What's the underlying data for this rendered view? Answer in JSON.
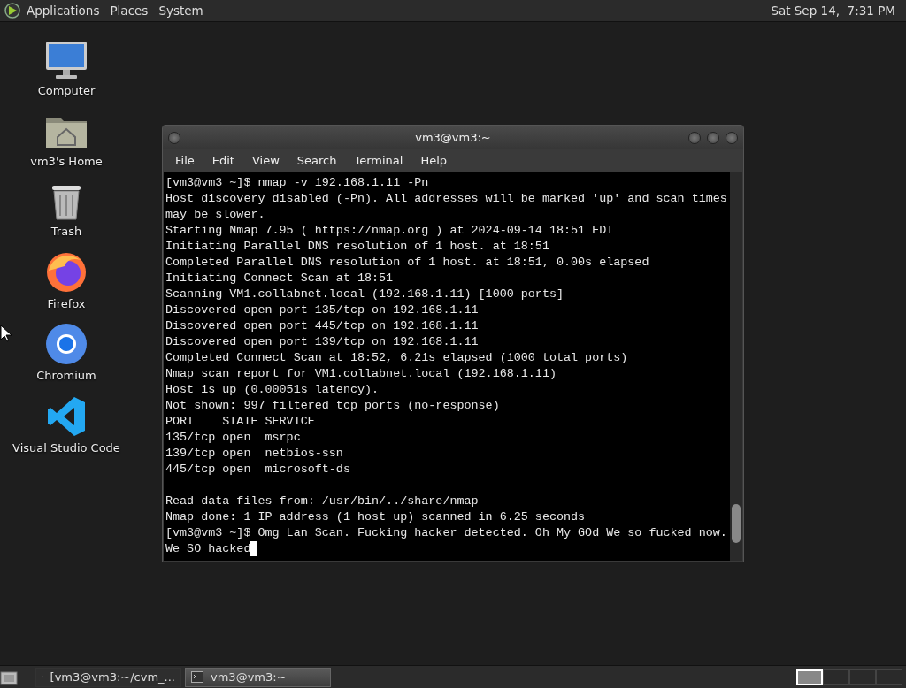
{
  "top_panel": {
    "menus": [
      "Applications",
      "Places",
      "System"
    ],
    "clock": "Sat Sep 14,  7:31 PM"
  },
  "desktop_icons": [
    {
      "kind": "computer",
      "label": "Computer"
    },
    {
      "kind": "home",
      "label": "vm3's Home"
    },
    {
      "kind": "trash",
      "label": "Trash"
    },
    {
      "kind": "firefox",
      "label": "Firefox"
    },
    {
      "kind": "chromium",
      "label": "Chromium"
    },
    {
      "kind": "vscode",
      "label": "Visual Studio Code"
    }
  ],
  "terminal": {
    "title": "vm3@vm3:~",
    "menu": [
      "File",
      "Edit",
      "View",
      "Search",
      "Terminal",
      "Help"
    ],
    "lines": [
      {
        "text": "[vm3@vm3 ~]$ nmap -v 192.168.1.11 -Pn"
      },
      {
        "text": "Host discovery disabled (-Pn). All addresses will be marked 'up' and scan times"
      },
      {
        "text": "may be slower."
      },
      {
        "text": "Starting Nmap 7.95 ( https://nmap.org ) at 2024-09-14 18:51 EDT"
      },
      {
        "text": "Initiating Parallel DNS resolution of 1 host. at 18:51"
      },
      {
        "text": "Completed Parallel DNS resolution of 1 host. at 18:51, 0.00s elapsed"
      },
      {
        "text": "Initiating Connect Scan at 18:51"
      },
      {
        "text": "Scanning VM1.collabnet.local (192.168.1.11) [1000 ports]"
      },
      {
        "text": "Discovered open port 135/tcp on 192.168.1.11"
      },
      {
        "text": "Discovered open port 445/tcp on 192.168.1.11"
      },
      {
        "text": "Discovered open port 139/tcp on 192.168.1.11"
      },
      {
        "text": "Completed Connect Scan at 18:52, 6.21s elapsed (1000 total ports)"
      },
      {
        "text": "Nmap scan report for VM1.collabnet.local (192.168.1.11)"
      },
      {
        "text": "Host is up (0.00051s latency)."
      },
      {
        "text": "Not shown: 997 filtered tcp ports (no-response)"
      },
      {
        "text": "PORT    STATE SERVICE"
      },
      {
        "text": "135/tcp open  msrpc"
      },
      {
        "text": "139/tcp open  netbios-ssn"
      },
      {
        "text": "445/tcp open  microsoft-ds"
      },
      {
        "text": "Read data files from: /usr/bin/../share/nmap",
        "blank_line_before": true
      },
      {
        "text": "Nmap done: 1 IP address (1 host up) scanned in 6.25 seconds"
      },
      {
        "text": "[vm3@vm3 ~]$ Omg Lan Scan. Fucking hacker detected. Oh My GOd We so fucked now."
      },
      {
        "text": "We SO hacked",
        "cursor": true
      }
    ]
  },
  "taskbar": {
    "tasks": [
      {
        "label": "[vm3@vm3:~/cvm_...",
        "selected": false
      },
      {
        "label": "vm3@vm3:~",
        "selected": true
      }
    ],
    "workspaces": [
      {
        "selected": true
      },
      {
        "selected": false
      },
      {
        "selected": false
      },
      {
        "selected": false
      }
    ]
  }
}
